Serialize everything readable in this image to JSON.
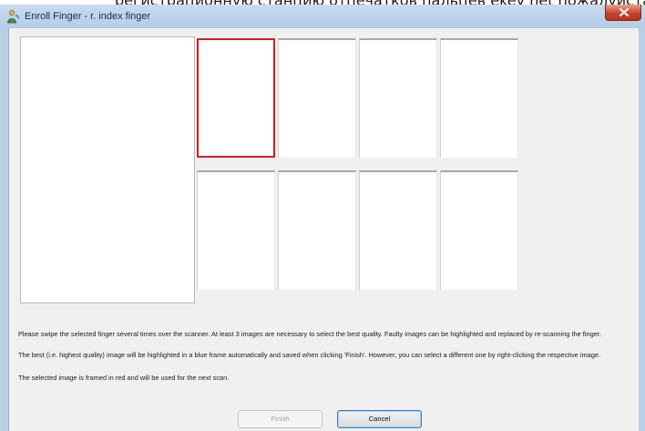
{
  "background": {
    "text": "регистрационную станцию отпечатков пальцев ekey net пожалуйста"
  },
  "window": {
    "title": "Enroll Finger - r. index finger",
    "icon": "fingerprint-app-icon",
    "close_icon": "close-icon"
  },
  "scans": {
    "top_row": [
      {
        "selected": true
      },
      {
        "selected": false
      },
      {
        "selected": false
      },
      {
        "selected": false
      }
    ],
    "bottom_row": [
      {
        "selected": false
      },
      {
        "selected": false
      },
      {
        "selected": false
      },
      {
        "selected": false
      }
    ]
  },
  "instructions": {
    "line1": "Please swipe the selected finger several times over the scanner. At least 3 images are necessary to select the best quality. Faulty images can be highlighted and replaced by re-scanning the finger.",
    "line2": "The best (i.e. highest quality) image will be highlighted in a blue frame automatically and saved when clicking 'Finish'. However, you can select a different one by right-clicking the respective image.",
    "line3": "The selected image is framed in red and will be used for the next scan."
  },
  "buttons": {
    "finish_label": "Finish",
    "finish_enabled": false,
    "cancel_label": "Cancel"
  },
  "colors": {
    "selected_frame": "#d21f1f",
    "best_frame": "#1f5fd2",
    "title_bar": "#b9d1ea"
  }
}
